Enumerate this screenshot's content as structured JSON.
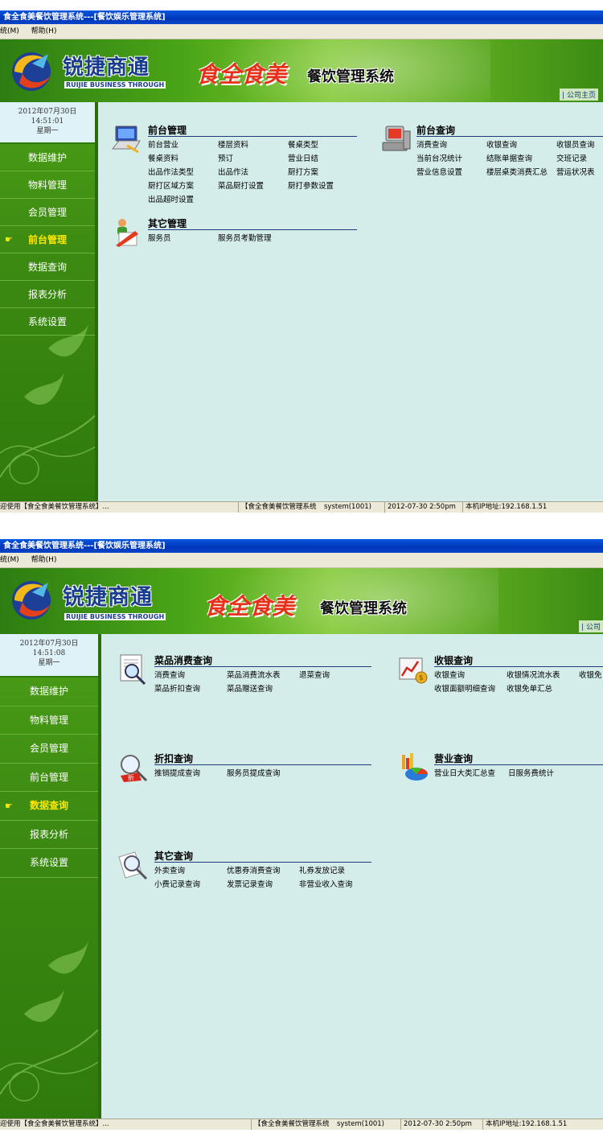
{
  "colors": {
    "title_bar": "#0036b8",
    "sidebar_green": "#3c8a12",
    "active_nav": "#ffe700",
    "content_bg": "#d4ecea",
    "heading_line": "#1f3a7a"
  },
  "windows": [
    {
      "title": "食全食美餐饮管理系统---[餐饮娱乐管理系统]",
      "menu": [
        "统(M)",
        "帮助(H)"
      ],
      "banner": {
        "logo_cn": "锐捷商通",
        "logo_en": "RUIJIE BUSINESS THROUGH",
        "brand": "食全食美",
        "system": "餐饮管理系统",
        "company_link": "| 公司主页"
      },
      "sidebar": {
        "date": "2012年07月30日",
        "time": "14:51:01",
        "weekday": "星期一",
        "pointer": "☛",
        "items": [
          {
            "label": "数据维护",
            "active": false
          },
          {
            "label": "物料管理",
            "active": false
          },
          {
            "label": "会员管理",
            "active": false
          },
          {
            "label": "前台管理",
            "active": true
          },
          {
            "label": "数据查询",
            "active": false
          },
          {
            "label": "报表分析",
            "active": false
          },
          {
            "label": "系统设置",
            "active": false
          }
        ]
      },
      "sections": [
        {
          "icon": "laptop-icon",
          "title": "前台管理",
          "links": [
            "前台营业",
            "楼层资料",
            "餐桌类型",
            "餐桌资料",
            "预订",
            "营业日结",
            "出品作法类型",
            "出品作法",
            "厨打方案",
            "厨打区域方案",
            "菜品厨打设置",
            "厨打参数设置",
            "出品超时设置"
          ]
        },
        {
          "icon": "computer-icon",
          "title": "前台查询",
          "links": [
            "消费查询",
            "收银查询",
            "收银员查询",
            "当前台况统计",
            "结账单据查询",
            "交班记录",
            "营业信息设置",
            "楼层桌类消费汇总",
            "营运状况表"
          ]
        },
        {
          "icon": "user-edit-icon",
          "title": "其它管理",
          "links": [
            "服务员",
            "服务员考勤管理"
          ]
        }
      ],
      "status": [
        "迎使用【食全食美餐饮管理系统】...",
        "【食全食美餐饮管理系统",
        "system(1001)",
        "2012-07-30 2:50pm",
        "本机IP地址:192.168.1.51"
      ]
    },
    {
      "title": "食全食美餐饮管理系统---[餐饮娱乐管理系统]",
      "menu": [
        "统(M)",
        "帮助(H)"
      ],
      "banner": {
        "logo_cn": "锐捷商通",
        "logo_en": "RUIJIE BUSINESS THROUGH",
        "brand": "食全食美",
        "system": "餐饮管理系统",
        "company_link": "| 公司"
      },
      "sidebar": {
        "date": "2012年07月30日",
        "time": "14:51:08",
        "weekday": "星期一",
        "pointer": "☛",
        "items": [
          {
            "label": "数据维护",
            "active": false
          },
          {
            "label": "物料管理",
            "active": false
          },
          {
            "label": "会员管理",
            "active": false
          },
          {
            "label": "前台管理",
            "active": false
          },
          {
            "label": "数据查询",
            "active": true
          },
          {
            "label": "报表分析",
            "active": false
          },
          {
            "label": "系统设置",
            "active": false
          }
        ]
      },
      "sections": [
        {
          "icon": "document-search-icon",
          "title": "菜品消费查询",
          "links": [
            "消费查询",
            "菜品消费流水表",
            "退菜查询",
            "菜品折扣查询",
            "菜品赠送查询"
          ]
        },
        {
          "icon": "chart-trend-icon",
          "title": "收银查询",
          "links": [
            "收银查询",
            "收银情况流水表",
            "收银免",
            "收银面额明细查询",
            "收银免单汇总"
          ]
        },
        {
          "icon": "discount-magnifier-icon",
          "title": "折扣查询",
          "links": [
            "推销提成查询",
            "服务员提成查询"
          ]
        },
        {
          "icon": "pie-chart-icon",
          "title": "营业查询",
          "links": [
            "营业日大类汇总查",
            "日服务费统计"
          ]
        },
        {
          "icon": "magnifier-icon",
          "title": "其它查询",
          "links": [
            "外卖查询",
            "优惠券消费查询",
            "礼券发放记录",
            "小费记录查询",
            "发票记录查询",
            "非营业收入查询"
          ]
        }
      ],
      "status": [
        "迎使用【食全食美餐饮管理系统】...",
        "【食全食美餐饮管理系统",
        "system(1001)",
        "2012-07-30 2:50pm",
        "本机IP地址:192.168.1.51"
      ]
    }
  ]
}
